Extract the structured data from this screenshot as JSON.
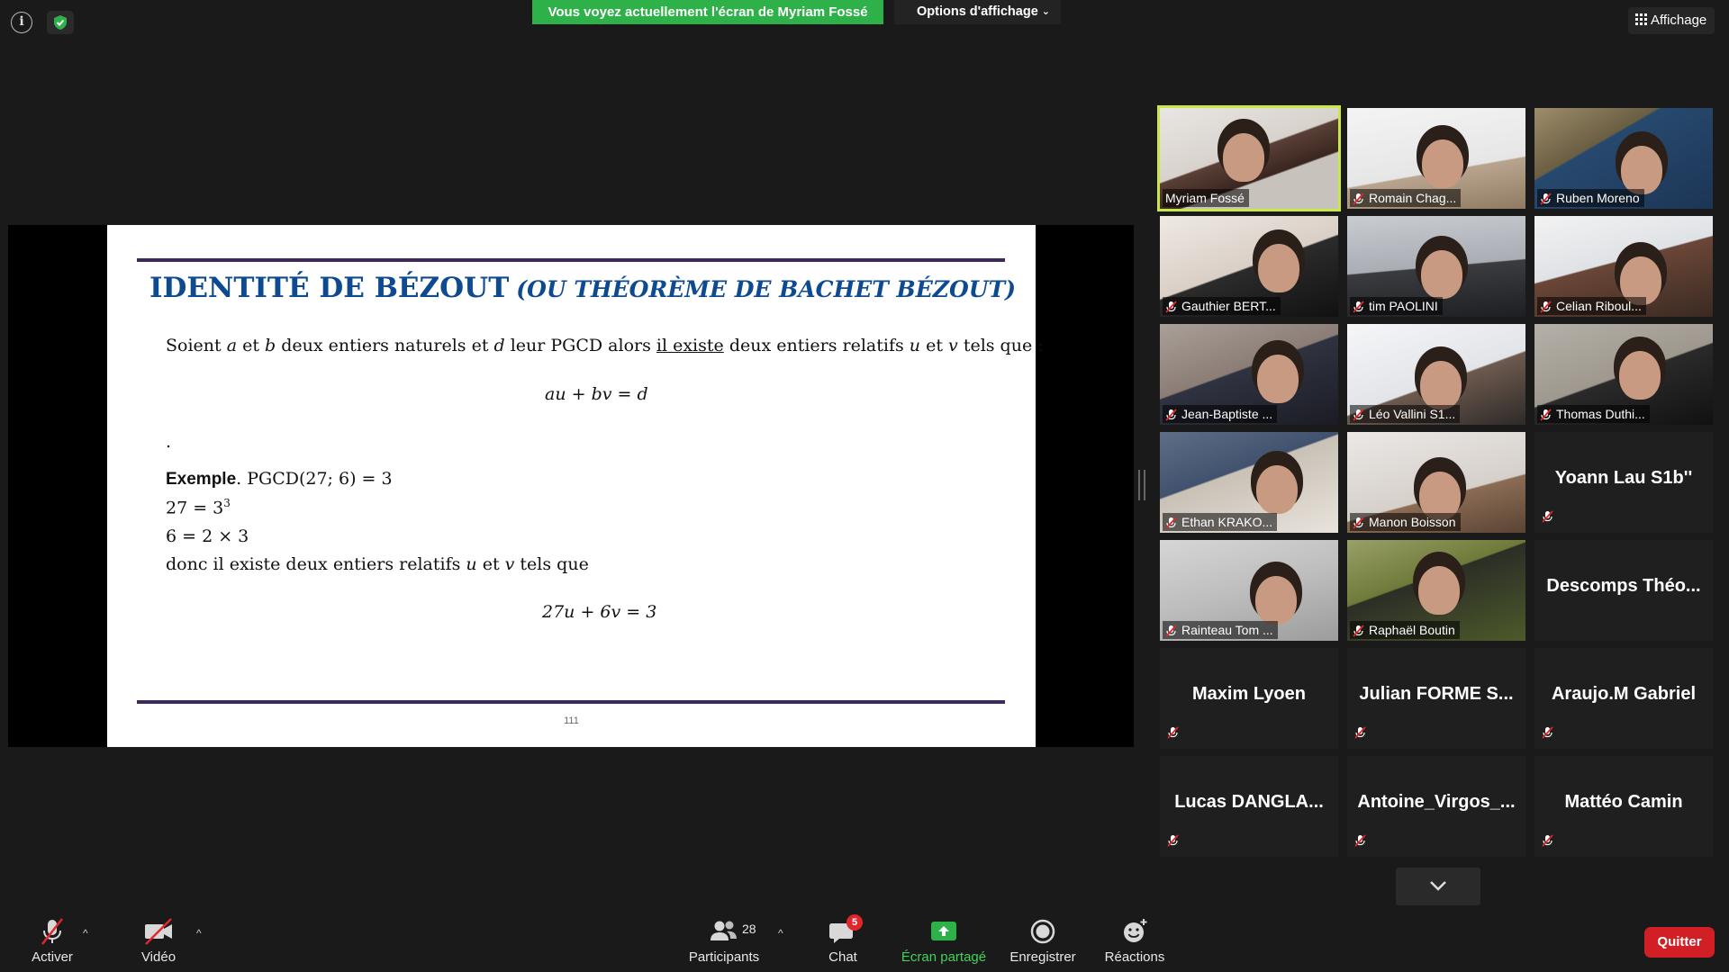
{
  "topbar": {
    "info_icon": "i",
    "shield_icon": "shield-check",
    "share_banner": "Vous voyez actuellement l'écran de Myriam Fossé",
    "view_options": "Options d'affichage",
    "affichage": "Affichage"
  },
  "slide": {
    "title": "IDENTITÉ DE BÉZOUT",
    "subtitle": "(OU THÉORÈME DE BACHET BÉZOUT)",
    "line1_a": "Soient",
    "line1_var_a": "a",
    "line1_et1": "et",
    "line1_var_b": "b",
    "line1_b": "deux entiers naturels et",
    "line1_var_d": "d",
    "line1_c": "leur PGCD alors",
    "line1_underline": "il existe",
    "line1_d": "deux entiers relatifs",
    "line1_var_u": "u",
    "line1_et2": "et",
    "line1_var_v": "v",
    "line1_e": "tels que :",
    "equation1": "au + bv = d",
    "dot": ".",
    "example_label": "Exemple",
    "example_rest": ". PGCD(27; 6) = 3",
    "line_27_base": "27 = 3",
    "line_27_exp": "3",
    "line_6": "6 = 2 × 3",
    "line_donc_a": "donc il existe deux entiers relatifs",
    "line_donc_u": "u",
    "line_donc_et": "et",
    "line_donc_v": "v",
    "line_donc_b": "tels que",
    "equation2": "27u + 6v = 3",
    "page_number": "111"
  },
  "participants": [
    {
      "name": "Myriam Fossé",
      "video": true,
      "muted": false,
      "active": true
    },
    {
      "name": "Romain Chag...",
      "video": true,
      "muted": true
    },
    {
      "name": "Ruben Moreno",
      "video": true,
      "muted": true
    },
    {
      "name": "Gauthier BERT...",
      "video": true,
      "muted": true
    },
    {
      "name": "tim PAOLINI",
      "video": true,
      "muted": true
    },
    {
      "name": "Celian Riboul...",
      "video": true,
      "muted": true
    },
    {
      "name": "Jean-Baptiste ...",
      "video": true,
      "muted": true
    },
    {
      "name": "Léo Vallini S1...",
      "video": true,
      "muted": true
    },
    {
      "name": "Thomas Duthi...",
      "video": true,
      "muted": true
    },
    {
      "name": "Ethan KRAKO...",
      "video": true,
      "muted": true
    },
    {
      "name": "Manon Boisson",
      "video": true,
      "muted": true
    },
    {
      "name": "Yoann Lau S1b''",
      "video": false,
      "muted": true
    },
    {
      "name": "Rainteau Tom ...",
      "video": true,
      "muted": true
    },
    {
      "name": "Raphaël Boutin",
      "video": true,
      "muted": true
    },
    {
      "name": "Descomps  Théo...",
      "video": false,
      "muted": false
    },
    {
      "name": "Maxim Lyoen",
      "video": false,
      "muted": true
    },
    {
      "name": "Julian  FORME  S...",
      "video": false,
      "muted": true
    },
    {
      "name": "Araujo.M Gabriel",
      "video": false,
      "muted": true
    },
    {
      "name": "Lucas  DANGLA...",
      "video": false,
      "muted": true
    },
    {
      "name": "Antoine_Virgos_...",
      "video": false,
      "muted": true
    },
    {
      "name": "Mattéo Camin",
      "video": false,
      "muted": true
    }
  ],
  "toolbar": {
    "mute_label": "Activer",
    "video_label": "Vidéo",
    "participants_label": "Participants",
    "participants_count": "28",
    "chat_label": "Chat",
    "chat_badge": "5",
    "share_label": "Écran partagé",
    "record_label": "Enregistrer",
    "reactions_label": "Réactions",
    "quit_label": "Quitter"
  },
  "colors": {
    "share_green": "#2fb14a",
    "active_speaker": "#c9e74a",
    "quit_red": "#d21f25",
    "slide_title": "#0e4a8f",
    "slide_rule": "#3d2a5a"
  }
}
